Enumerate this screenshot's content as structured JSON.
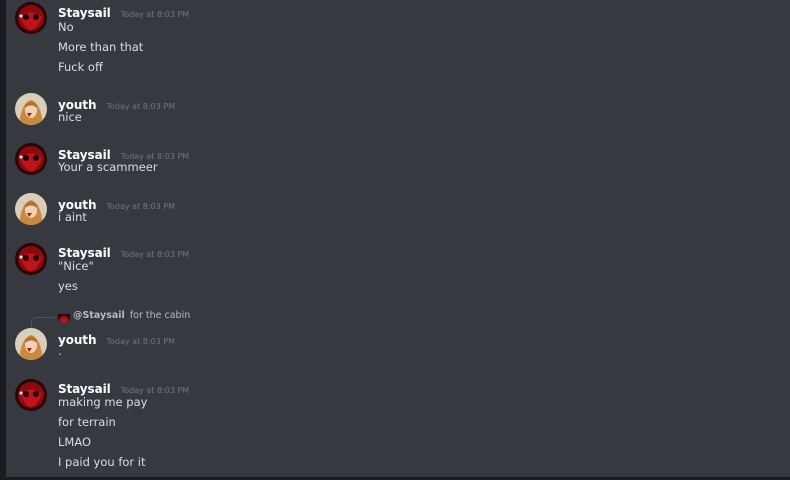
{
  "messages": [
    {
      "username": "Staysail",
      "timestamp": "Today at 8:03 PM",
      "avatar": "red-mask-avatar",
      "lines": [
        "No",
        "More than that",
        "Fuck off"
      ]
    },
    {
      "username": "youth",
      "timestamp": "Today at 8:03 PM",
      "avatar": "anime-girl-avatar",
      "lines": [
        "nice"
      ]
    },
    {
      "username": "Staysail",
      "timestamp": "Today at 8:03 PM",
      "avatar": "red-mask-avatar",
      "lines": [
        "Your a scammeer"
      ]
    },
    {
      "username": "youth",
      "timestamp": "Today at 8:03 PM",
      "avatar": "anime-girl-avatar",
      "lines": [
        "i aint"
      ]
    },
    {
      "username": "Staysail",
      "timestamp": "Today at 8:03 PM",
      "avatar": "red-mask-avatar",
      "lines": [
        "\"Nice\"",
        "yes"
      ]
    },
    {
      "username": "youth",
      "timestamp": "Today at 8:03 PM",
      "avatar": "anime-girl-avatar",
      "reply": {
        "mention": "@Staysail",
        "content": "for the cabin"
      },
      "lines": [
        "."
      ]
    },
    {
      "username": "Staysail",
      "timestamp": "Today at 8:03 PM",
      "avatar": "red-mask-avatar",
      "lines": [
        "making me pay",
        "for terrain",
        "LMAO",
        "I paid you for it"
      ]
    }
  ],
  "colors": {
    "background": "#36393f",
    "username": "#ffffff",
    "message_text": "#dcddde",
    "timestamp": "#72767d"
  }
}
